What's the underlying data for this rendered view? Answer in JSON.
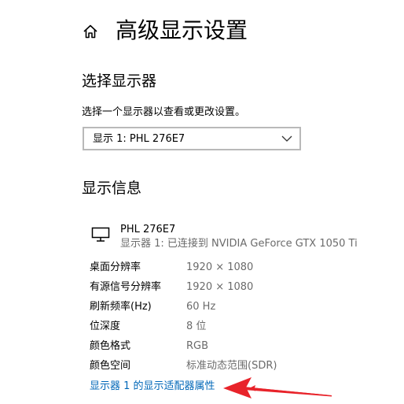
{
  "header": {
    "title": "高级显示设置",
    "home_icon": "home-icon"
  },
  "select_display": {
    "heading": "选择显示器",
    "hint": "选择一个显示器以查看或更改设置。",
    "selected_value": "显示 1: PHL 276E7",
    "chevron_icon": "chevron-down-icon"
  },
  "display_info": {
    "heading": "显示信息",
    "monitor_icon": "monitor-icon",
    "display_name": "PHL 276E7",
    "connection": "显示器 1: 已连接到 NVIDIA GeForce GTX 1050 Ti",
    "rows": [
      {
        "label": "桌面分辨率",
        "value": "1920 × 1080"
      },
      {
        "label": "有源信号分辨率",
        "value": "1920 × 1080"
      },
      {
        "label": "刷新频率(Hz)",
        "value": "60 Hz"
      },
      {
        "label": "位深度",
        "value": "8 位"
      },
      {
        "label": "颜色格式",
        "value": "RGB"
      },
      {
        "label": "颜色空间",
        "value": "标准动态范围(SDR)"
      }
    ],
    "adapter_link": "显示器 1 的显示适配器属性"
  },
  "colors": {
    "link": "#0067b8",
    "secondary_text": "#6b6b6b",
    "annotation_arrow": "#e8232a"
  }
}
